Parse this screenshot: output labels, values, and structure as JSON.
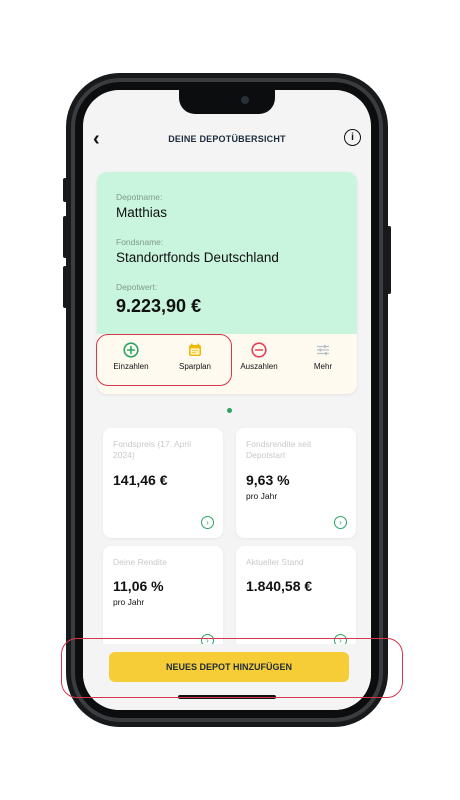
{
  "header": {
    "back_icon": "chevron-left-icon",
    "title": "DEINE DEPOTÜBERSICHT",
    "info_icon": "info-icon"
  },
  "depot": {
    "depotname_label": "Depotname:",
    "depotname": "Matthias",
    "fondsname_label": "Fondsname:",
    "fondsname": "Standortfonds Deutschland",
    "depotwert_label": "Depotwert:",
    "depotwert": "9.223,90 €"
  },
  "actions": [
    {
      "label": "Einzahlen",
      "icon": "plus-circle-icon",
      "color": "#2aa465"
    },
    {
      "label": "Sparplan",
      "icon": "calendar-icon",
      "color": "#f2b705"
    },
    {
      "label": "Auszahlen",
      "icon": "minus-circle-icon",
      "color": "#e0405a"
    },
    {
      "label": "Mehr",
      "icon": "sliders-icon",
      "color": "#b9c1c9"
    }
  ],
  "stats": [
    {
      "label": "Fondspreis (17. April 2024)",
      "value": "141,46 €",
      "sub": ""
    },
    {
      "label": "Fondsrendite seit Depotstart",
      "value": "9,63 %",
      "sub": "pro Jahr"
    },
    {
      "label": "Deine Rendite",
      "value": "11,06 %",
      "sub": "pro Jahr"
    },
    {
      "label": "Aktueller Stand",
      "value": "1.840,58 €",
      "sub": ""
    }
  ],
  "cta": {
    "label": "NEUES DEPOT HINZUFÜGEN"
  },
  "colors": {
    "accent_green": "#2aa465",
    "card_green": "#c9f4dd",
    "cta_yellow": "#f7cd37",
    "highlight_red": "#d6364a"
  }
}
